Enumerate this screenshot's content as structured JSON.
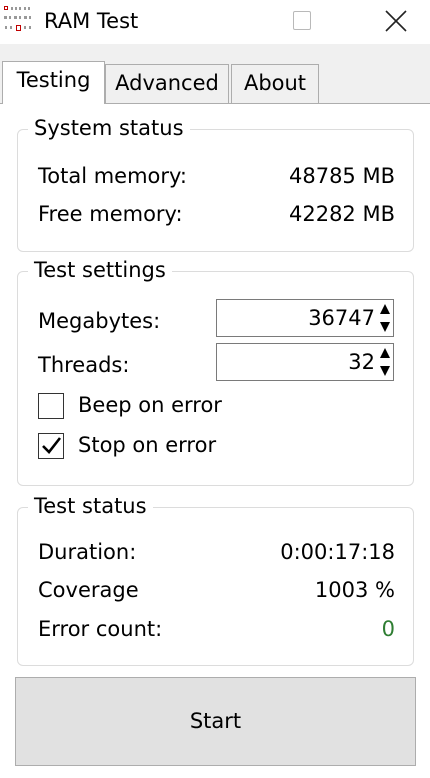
{
  "window": {
    "title": "RAM Test",
    "icon": "memory-chip-icon",
    "controls": [
      "maximize-icon",
      "close-icon"
    ]
  },
  "tabs": [
    {
      "label": "Testing",
      "active": true
    },
    {
      "label": "Advanced",
      "active": false
    },
    {
      "label": "About",
      "active": false
    }
  ],
  "system_status": {
    "title": "System status",
    "rows": [
      {
        "label": "Total memory:",
        "value": "48785 MB"
      },
      {
        "label": "Free memory:",
        "value": "42282 MB"
      }
    ]
  },
  "test_settings": {
    "title": "Test settings",
    "megabytes": {
      "label": "Megabytes:",
      "value": "36747"
    },
    "threads": {
      "label": "Threads:",
      "value": "32"
    },
    "beep_on_error": {
      "label": "Beep on error",
      "checked": false
    },
    "stop_on_error": {
      "label": "Stop on error",
      "checked": true
    }
  },
  "test_status": {
    "title": "Test status",
    "rows": [
      {
        "label": "Duration:",
        "value": "0:00:17:18"
      },
      {
        "label": "Coverage",
        "value": "1003 %"
      },
      {
        "label": "Error count:",
        "value": "0"
      }
    ],
    "error_count_color": "#2e7d32"
  },
  "start_button": {
    "label": "Start"
  }
}
